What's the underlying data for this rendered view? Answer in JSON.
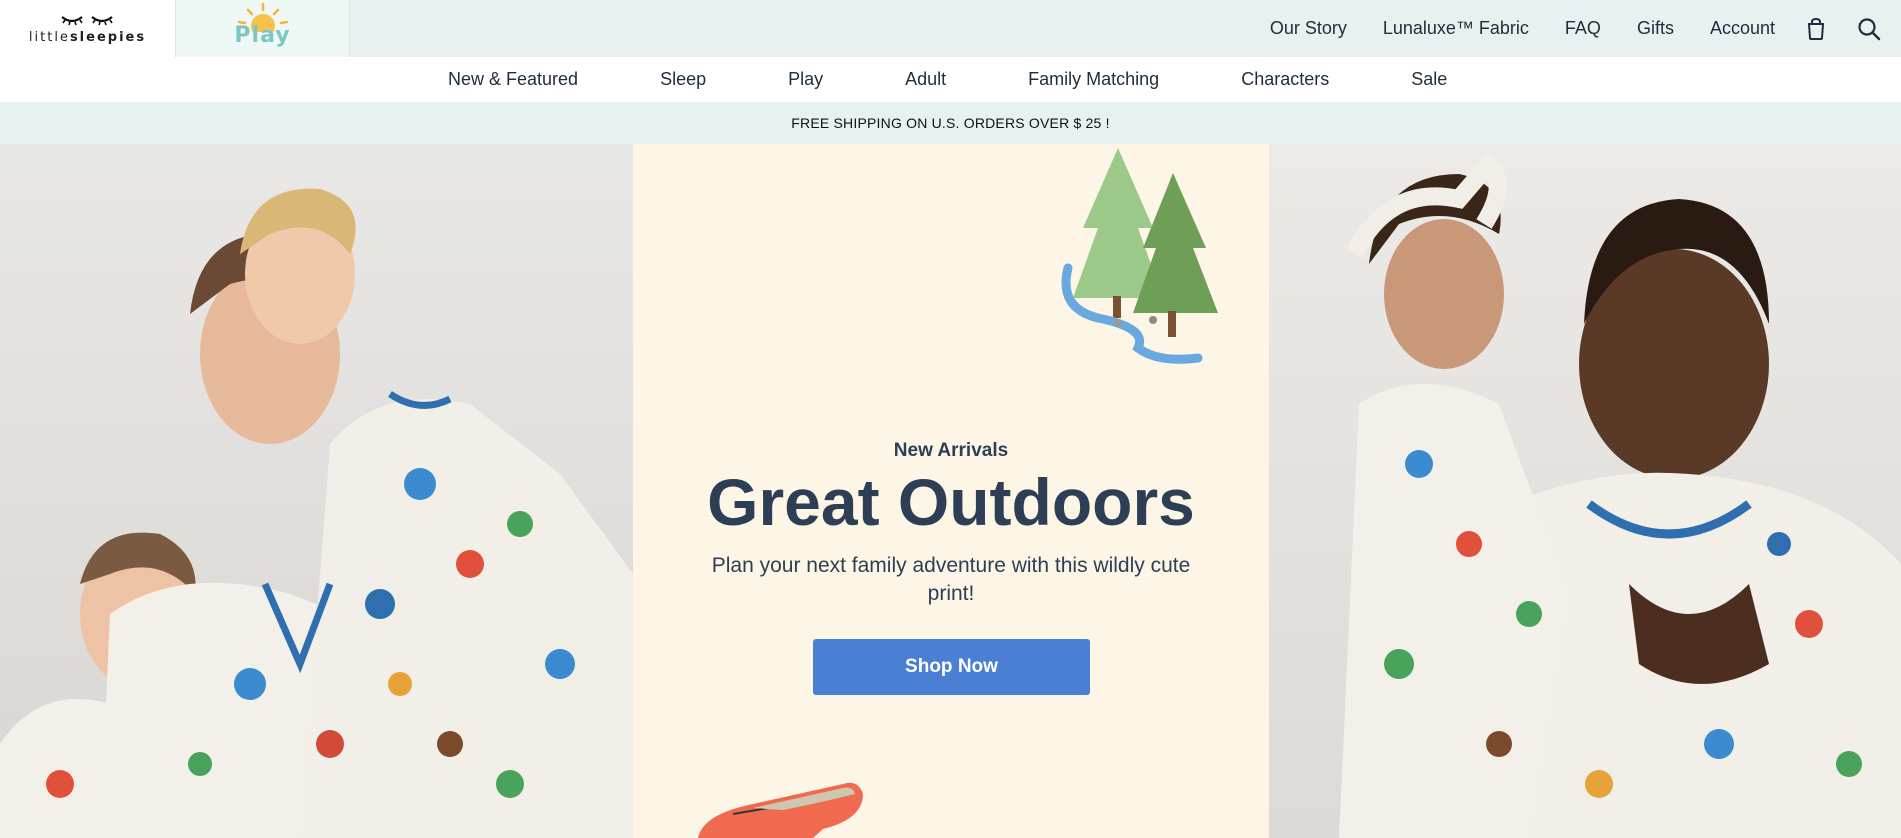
{
  "brand": {
    "logo_text_light": "little",
    "logo_text_bold": "sleepies",
    "play_tab_label": "Play"
  },
  "top_links": [
    "Our Story",
    "Lunaluxe™ Fabric",
    "FAQ",
    "Gifts",
    "Account"
  ],
  "icons": {
    "cart": "shopping-bag-icon",
    "search": "search-icon"
  },
  "nav": [
    "New & Featured",
    "Sleep",
    "Play",
    "Adult",
    "Family Matching",
    "Characters",
    "Sale"
  ],
  "promo": "FREE SHIPPING ON U.S. ORDERS OVER $ 25 !",
  "hero": {
    "eyebrow": "New Arrivals",
    "title": "Great Outdoors",
    "subtitle": "Plan your next family adventure with this wildly cute print!",
    "cta": "Shop Now"
  },
  "colors": {
    "topbar_bg": "#e7f1ef",
    "promo_bg": "#e5f2f1",
    "hero_center_bg": "#fdf6e6",
    "heading": "#2e3f55",
    "cta_bg": "#4a7fd4"
  }
}
